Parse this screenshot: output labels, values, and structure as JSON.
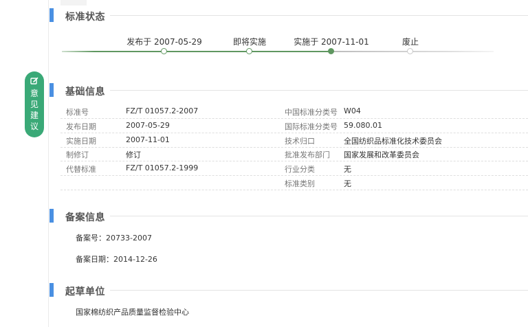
{
  "sections": {
    "status": "标准状态",
    "basic": "基础信息",
    "registration": "备案信息",
    "drafter": "起草单位"
  },
  "timeline": [
    {
      "label": "发布于 2007-05-29",
      "state": "done"
    },
    {
      "label": "即将实施",
      "state": "done"
    },
    {
      "label": "实施于 2007-11-01",
      "state": "current"
    },
    {
      "label": "废止",
      "state": "future"
    }
  ],
  "basic_info": {
    "left": [
      {
        "label": "标准号",
        "value": "FZ/T 01057.2-2007"
      },
      {
        "label": "发布日期",
        "value": "2007-05-29"
      },
      {
        "label": "实施日期",
        "value": "2007-11-01"
      },
      {
        "label": "制修订",
        "value": "修订"
      },
      {
        "label": "代替标准",
        "value": "FZ/T 01057.2-1999"
      }
    ],
    "right": [
      {
        "label": "中国标准分类号",
        "value": "W04"
      },
      {
        "label": "国际标准分类号",
        "value": "59.080.01"
      },
      {
        "label": "技术归口",
        "value": "全国纺织品标准化技术委员会"
      },
      {
        "label": "批准发布部门",
        "value": "国家发展和改革委员会"
      },
      {
        "label": "行业分类",
        "value": "无"
      },
      {
        "label": "标准类别",
        "value": "无"
      }
    ]
  },
  "registration": {
    "number": "备案号：20733-2007",
    "date": "备案日期：2014-12-26"
  },
  "drafter": {
    "unit": "国家棉纺织产品质量监督检验中心"
  },
  "feedback": {
    "label": "意见建议",
    "icon": "edit-icon"
  },
  "colors": {
    "accent_blue": "#4a90e2",
    "timeline_green": "#5f9760",
    "feedback_green": "#3aa977"
  }
}
